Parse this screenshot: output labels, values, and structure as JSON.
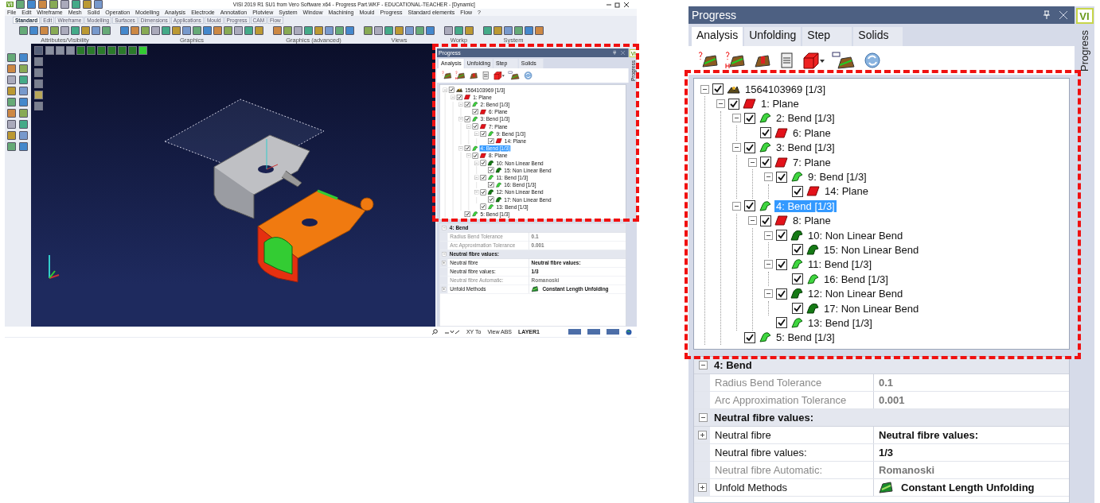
{
  "cad_window": {
    "app_logo": "VI",
    "title": "VISI 2019 R1 SU1 from Vero Software x64 - Progress Part.WKF - EDUCATIONAL-TEACHER - [Dynamic]",
    "menu": [
      "File",
      "Edit",
      "Wireframe",
      "Mesh",
      "Solid",
      "Operation",
      "Modelling",
      "Analysis",
      "Electrode",
      "Annotation",
      "Plotview",
      "System",
      "Window",
      "Machining",
      "Mould",
      "Progress",
      "Standard elements",
      "Flow",
      "?"
    ],
    "ribbon_tabs": [
      {
        "label": "Standard",
        "selected": true
      },
      {
        "label": "Edit",
        "selected": false
      },
      {
        "label": "Wireframe",
        "selected": false
      },
      {
        "label": "Modelling",
        "selected": false
      },
      {
        "label": "Surfaces",
        "selected": false
      },
      {
        "label": "Dimensions",
        "selected": false
      },
      {
        "label": "Applications",
        "selected": false
      },
      {
        "label": "Mould",
        "selected": false
      },
      {
        "label": "Progress",
        "selected": false
      },
      {
        "label": "CAM",
        "selected": false
      },
      {
        "label": "Flow",
        "selected": false
      }
    ],
    "toolbar_groups": [
      "Attributes/Visibility",
      "Graphics",
      "Graphics (advanced)",
      "Views",
      "Workp",
      "System"
    ],
    "progress_panel": {
      "title": "Progress",
      "side_tab": "Progress",
      "logo": "VI",
      "tabs": [
        {
          "label": "Analysis",
          "selected": true
        },
        {
          "label": "Unfolding",
          "selected": false
        },
        {
          "label": "Step",
          "selected": false
        },
        {
          "label": "Solids",
          "selected": false
        }
      ],
      "tree": [
        {
          "label": "1564103969 [1/3]",
          "kind": "part",
          "checked": true,
          "selected": false,
          "children": [
            {
              "label": "1: Plane",
              "kind": "plane",
              "checked": true,
              "selected": false,
              "children": [
                {
                  "label": "2: Bend [1/3]",
                  "kind": "bend",
                  "checked": true,
                  "selected": false,
                  "children": [
                    {
                      "label": "6: Plane",
                      "kind": "plane",
                      "checked": true,
                      "selected": false
                    }
                  ]
                },
                {
                  "label": "3: Bend [1/3]",
                  "kind": "bend",
                  "checked": true,
                  "selected": false,
                  "children": [
                    {
                      "label": "7: Plane",
                      "kind": "plane",
                      "checked": true,
                      "selected": false,
                      "children": [
                        {
                          "label": "9: Bend [1/3]",
                          "kind": "bend",
                          "checked": true,
                          "selected": false,
                          "children": [
                            {
                              "label": "14: Plane",
                              "kind": "plane",
                              "checked": true,
                              "selected": false
                            }
                          ]
                        }
                      ]
                    }
                  ]
                },
                {
                  "label": "4: Bend [1/3]",
                  "kind": "bend",
                  "checked": true,
                  "selected": true,
                  "children": [
                    {
                      "label": "8: Plane",
                      "kind": "plane",
                      "checked": true,
                      "selected": false,
                      "children": [
                        {
                          "label": "10: Non Linear Bend",
                          "kind": "nonlinear",
                          "checked": true,
                          "selected": false,
                          "children": [
                            {
                              "label": "15: Non Linear Bend",
                              "kind": "nonlinear",
                              "checked": true,
                              "selected": false
                            }
                          ]
                        },
                        {
                          "label": "11: Bend [1/3]",
                          "kind": "bend",
                          "checked": true,
                          "selected": false,
                          "children": [
                            {
                              "label": "16: Bend [1/3]",
                              "kind": "bend",
                              "checked": true,
                              "selected": false
                            }
                          ]
                        },
                        {
                          "label": "12: Non Linear Bend",
                          "kind": "nonlinear",
                          "checked": true,
                          "selected": false,
                          "children": [
                            {
                              "label": "17: Non Linear Bend",
                              "kind": "nonlinear",
                              "checked": true,
                              "selected": false
                            }
                          ]
                        },
                        {
                          "label": "13: Bend [1/3]",
                          "kind": "bend",
                          "checked": true,
                          "selected": false
                        }
                      ]
                    }
                  ]
                },
                {
                  "label": "5: Bend [1/3]",
                  "kind": "bend",
                  "checked": true,
                  "selected": false
                }
              ]
            }
          ]
        }
      ],
      "properties": [
        {
          "title": "4: Bend",
          "expanded": true,
          "rows": [
            {
              "name": "Radius Bend Tolerance",
              "value": "0.1",
              "disabled": true,
              "expandable": false,
              "kind": "text"
            },
            {
              "name": "Arc Approximation Tolerance",
              "value": "0.001",
              "disabled": true,
              "expandable": false,
              "kind": "text"
            }
          ]
        },
        {
          "title": "Neutral fibre values:",
          "expanded": true,
          "rows": [
            {
              "name": "Neutral fibre",
              "value": "Neutral fibre values:",
              "disabled": false,
              "expandable": true,
              "kind": "text"
            },
            {
              "name": "Neutral fibre values:",
              "value": "1/3",
              "disabled": false,
              "expandable": false,
              "kind": "text"
            },
            {
              "name": "Neutral fibre Automatic:",
              "value": "Romanoski",
              "disabled": true,
              "expandable": false,
              "kind": "text"
            },
            {
              "name": "Unfold Methods",
              "value": "Constant Length Unfolding",
              "disabled": false,
              "expandable": true,
              "kind": "method"
            }
          ]
        }
      ]
    },
    "status_bar": [
      "XY To",
      "View ABS",
      "LAYER1"
    ]
  },
  "zoomed_progress_panel": {
    "title": "Progress",
    "side_tab": "Progress",
    "logo": "VI",
    "tabs": [
      {
        "label": "Analysis",
        "selected": true
      },
      {
        "label": "Unfolding",
        "selected": false
      },
      {
        "label": "Step",
        "selected": false
      },
      {
        "label": "Solids",
        "selected": false
      }
    ],
    "tree": [
      {
        "label": "1564103969 [1/3]",
        "kind": "part",
        "checked": true,
        "selected": false,
        "children": [
          {
            "label": "1: Plane",
            "kind": "plane",
            "checked": true,
            "selected": false,
            "children": [
              {
                "label": "2: Bend [1/3]",
                "kind": "bend",
                "checked": true,
                "selected": false,
                "children": [
                  {
                    "label": "6: Plane",
                    "kind": "plane",
                    "checked": true,
                    "selected": false
                  }
                ]
              },
              {
                "label": "3: Bend [1/3]",
                "kind": "bend",
                "checked": true,
                "selected": false,
                "children": [
                  {
                    "label": "7: Plane",
                    "kind": "plane",
                    "checked": true,
                    "selected": false,
                    "children": [
                      {
                        "label": "9: Bend [1/3]",
                        "kind": "bend",
                        "checked": true,
                        "selected": false,
                        "children": [
                          {
                            "label": "14: Plane",
                            "kind": "plane",
                            "checked": true,
                            "selected": false
                          }
                        ]
                      }
                    ]
                  }
                ]
              },
              {
                "label": "4: Bend [1/3]",
                "kind": "bend",
                "checked": true,
                "selected": true,
                "children": [
                  {
                    "label": "8: Plane",
                    "kind": "plane",
                    "checked": true,
                    "selected": false,
                    "children": [
                      {
                        "label": "10: Non Linear Bend",
                        "kind": "nonlinear",
                        "checked": true,
                        "selected": false,
                        "children": [
                          {
                            "label": "15: Non Linear Bend",
                            "kind": "nonlinear",
                            "checked": true,
                            "selected": false
                          }
                        ]
                      },
                      {
                        "label": "11: Bend [1/3]",
                        "kind": "bend",
                        "checked": true,
                        "selected": false,
                        "children": [
                          {
                            "label": "16: Bend [1/3]",
                            "kind": "bend",
                            "checked": true,
                            "selected": false
                          }
                        ]
                      },
                      {
                        "label": "12: Non Linear Bend",
                        "kind": "nonlinear",
                        "checked": true,
                        "selected": false,
                        "children": [
                          {
                            "label": "17: Non Linear Bend",
                            "kind": "nonlinear",
                            "checked": true,
                            "selected": false
                          }
                        ]
                      },
                      {
                        "label": "13: Bend [1/3]",
                        "kind": "bend",
                        "checked": true,
                        "selected": false
                      }
                    ]
                  }
                ]
              },
              {
                "label": "5: Bend [1/3]",
                "kind": "bend",
                "checked": true,
                "selected": false
              }
            ]
          }
        ]
      }
    ],
    "properties": [
      {
        "title": "4: Bend",
        "expanded": true,
        "rows": [
          {
            "name": "Radius Bend Tolerance",
            "value": "0.1",
            "disabled": true,
            "expandable": false,
            "kind": "text"
          },
          {
            "name": "Arc Approximation Tolerance",
            "value": "0.001",
            "disabled": true,
            "expandable": false,
            "kind": "text"
          }
        ]
      },
      {
        "title": "Neutral fibre values:",
        "expanded": true,
        "rows": [
          {
            "name": "Neutral fibre",
            "value": "Neutral fibre values:",
            "disabled": false,
            "expandable": true,
            "kind": "text"
          },
          {
            "name": "Neutral fibre values:",
            "value": "1/3",
            "disabled": false,
            "expandable": false,
            "kind": "text"
          },
          {
            "name": "Neutral fibre Automatic:",
            "value": "Romanoski",
            "disabled": true,
            "expandable": false,
            "kind": "text"
          },
          {
            "name": "Unfold Methods",
            "value": "Constant Length Unfolding",
            "disabled": false,
            "expandable": true,
            "kind": "method"
          }
        ]
      }
    ]
  }
}
